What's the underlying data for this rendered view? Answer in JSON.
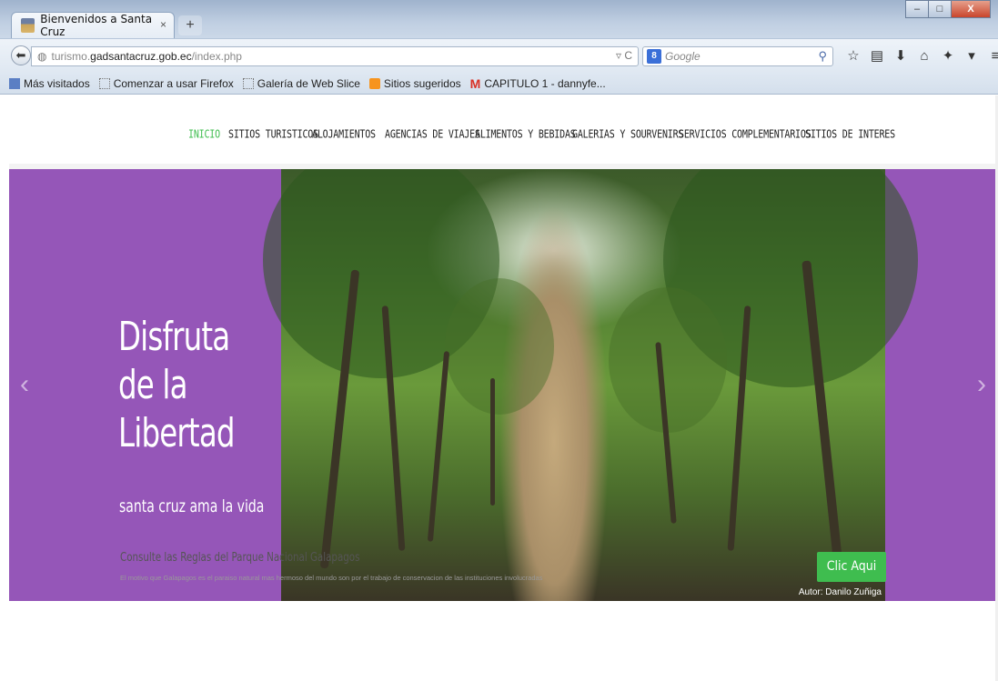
{
  "browser": {
    "tab_title": "Bienvenidos a Santa Cruz",
    "tab_close": "×",
    "new_tab": "+",
    "url_host": "turismo.",
    "url_domain": "gadsantacruz.gob.ec",
    "url_path": "/index.php",
    "url_actions": "▿ C",
    "search_engine_badge": "8",
    "search_placeholder": "Google",
    "window_controls": {
      "minimize": "–",
      "maximize": "□",
      "close": "X"
    },
    "bookmarks": [
      {
        "label": "Más visitados",
        "icon": "blue-bookmark-icon"
      },
      {
        "label": "Comenzar a usar Firefox",
        "icon": "dotted-page-icon"
      },
      {
        "label": "Galería de Web Slice",
        "icon": "dotted-page-icon"
      },
      {
        "label": "Sitios sugeridos",
        "icon": "orange-feed-icon"
      },
      {
        "label": "CAPITULO 1 - dannyfe...",
        "icon": "gmail-icon"
      }
    ]
  },
  "site_nav": {
    "items": [
      {
        "label": "INICIO",
        "active": true
      },
      {
        "label": "SITIOS TURISTICOS"
      },
      {
        "label": "ALOJAMIENTOS"
      },
      {
        "label": "AGENCIAS DE VIAJES"
      },
      {
        "label": "ALIMENTOS Y BEBIDAS"
      },
      {
        "label": "GALERIAS Y SOURVENIRS"
      },
      {
        "label": "SERVICIOS COMPLEMENTARIOS"
      },
      {
        "label": "SITIOS DE INTERES"
      }
    ],
    "active_color": "#3fbd4f"
  },
  "slider": {
    "heading_line1": "Disfruta",
    "heading_line2": "de la",
    "heading_line3": "Libertad",
    "subheading": "santa cruz ama la vida",
    "photo_credit": "Autor: Danilo Zuñiga",
    "prev_arrow": "‹",
    "next_arrow": "›",
    "background_color": "#9556b8"
  },
  "cta": {
    "title": "Consulte las Reglas del Parque Nacional Galapagos",
    "text": "El motivo que Galapagos es el paraiso natural mas hermoso del mundo son por el trabajo de conservacion de las instituciones involucradas",
    "button_label": "Clic Aqui",
    "button_color": "#3fbd4f"
  }
}
